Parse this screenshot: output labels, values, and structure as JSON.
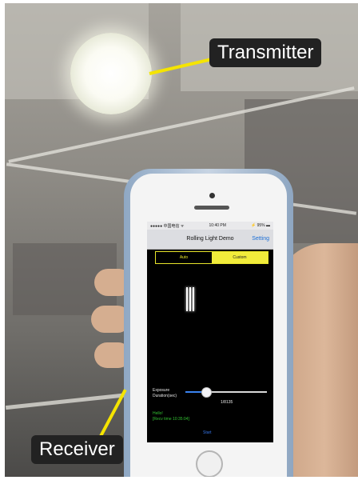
{
  "callouts": {
    "transmitter": "Transmitter",
    "receiver": "Receiver"
  },
  "app": {
    "status_bar": {
      "carrier": "●●●●● 中国电信 ᯤ",
      "time": "10:40 PM",
      "battery": "⚡ 95% ▬"
    },
    "title": "Rolling Light Demo",
    "setting_label": "Setting",
    "tabs": [
      "Auto",
      "Custom"
    ],
    "selected_tab": "Custom",
    "exposure_label": "Exposure\nDuration(sec)",
    "exposure_value": "1/8135",
    "exposure_slider_fraction": 0.25,
    "status_lines": [
      "Hello!",
      "[Recv time 10:35:04]"
    ],
    "start_label": "Start"
  },
  "colors": {
    "callout_line": "#f5e400",
    "segment_accent": "#f1ec3b",
    "link_blue": "#1d6fd6",
    "status_green": "#32c232"
  }
}
